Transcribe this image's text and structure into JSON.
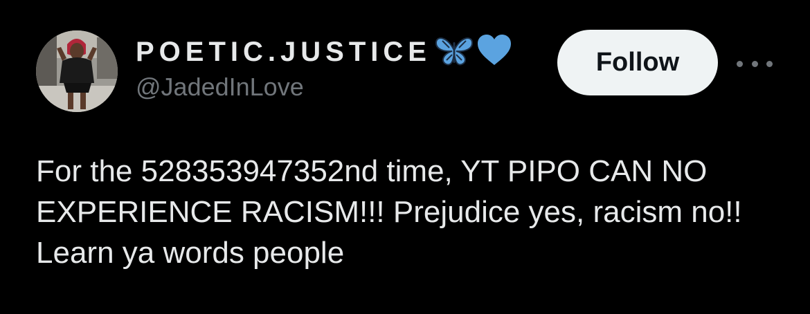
{
  "author": {
    "display_name": "POETIC.JUSTICE",
    "handle": "@JadedInLove",
    "name_emojis": [
      "butterfly-icon",
      "blue-heart-icon"
    ]
  },
  "actions": {
    "follow_label": "Follow",
    "more_icon": "more-options-icon"
  },
  "tweet": {
    "text": "For the 528353947352nd time, YT PIPO CAN NO EXPERIENCE RACISM!!! Prejudice yes, racism no!! Learn ya words people"
  },
  "colors": {
    "background": "#000000",
    "text_primary": "#e7e9ea",
    "text_secondary": "#71767b",
    "button_bg": "#eff3f4",
    "button_text": "#0f1419",
    "emoji_blue": "#5ba3e0"
  }
}
